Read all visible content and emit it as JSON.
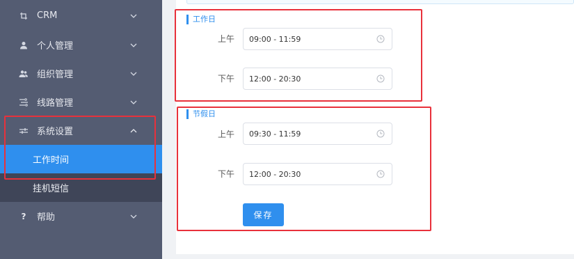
{
  "sidebar": {
    "items": [
      {
        "icon": "crop-icon",
        "label": "CRM"
      },
      {
        "icon": "user-icon",
        "label": "个人管理"
      },
      {
        "icon": "group-icon",
        "label": "组织管理"
      },
      {
        "icon": "route-icon",
        "label": "线路管理"
      },
      {
        "icon": "settings-sliders-icon",
        "label": "系统设置",
        "expanded": true,
        "children": [
          {
            "label": "工作时间",
            "active": true
          },
          {
            "label": "挂机短信",
            "active": false
          }
        ]
      },
      {
        "icon": "question-icon",
        "label": "帮助"
      }
    ]
  },
  "workday": {
    "title": "工作日",
    "morning_label": "上午",
    "morning_value": "09:00 - 11:59",
    "afternoon_label": "下午",
    "afternoon_value": "12:00 - 20:30"
  },
  "holiday": {
    "title": "节假日",
    "morning_label": "上午",
    "morning_value": "09:30 - 11:59",
    "afternoon_label": "下午",
    "afternoon_value": "12:00 - 20:30"
  },
  "actions": {
    "save_label": "保存"
  },
  "colors": {
    "sidebar_bg": "#545c72",
    "accent": "#2f8fee",
    "annotation_red": "#e8313b"
  }
}
